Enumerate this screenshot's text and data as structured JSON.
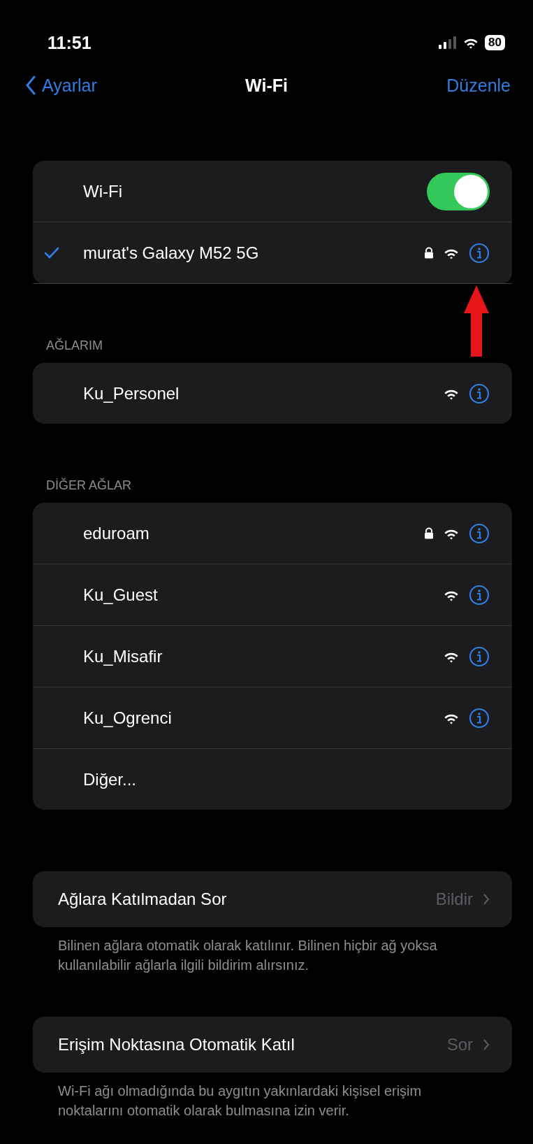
{
  "status_bar": {
    "time": "11:51",
    "battery": "80"
  },
  "nav": {
    "back": "Ayarlar",
    "title": "Wi-Fi",
    "action": "Düzenle"
  },
  "wifi_toggle": {
    "label": "Wi-Fi",
    "on": true
  },
  "connected": {
    "name": "murat's Galaxy M52 5G",
    "selected": true,
    "locked": true,
    "annotated": true
  },
  "sections": [
    {
      "header": "AĞLARIM",
      "networks": [
        {
          "kind": "network",
          "name": "Ku_Personel",
          "locked": false
        }
      ]
    },
    {
      "header": "DİĞER AĞLAR",
      "networks": [
        {
          "kind": "network",
          "name": "eduroam",
          "locked": true
        },
        {
          "kind": "network",
          "name": "Ku_Guest",
          "locked": false
        },
        {
          "kind": "network",
          "name": "Ku_Misafir",
          "locked": false
        },
        {
          "kind": "network",
          "name": "Ku_Ogrenci",
          "locked": false
        },
        {
          "kind": "other",
          "name": "Diğer..."
        }
      ]
    }
  ],
  "settings": [
    {
      "label": "Ağlara Katılmadan Sor",
      "value": "Bildir",
      "footer": "Bilinen ağlara otomatik olarak katılınır. Bilinen hiçbir ağ yoksa kullanılabilir ağlarla ilgili bildirim alırsınız."
    },
    {
      "label": "Erişim Noktasına Otomatik Katıl",
      "value": "Sor",
      "footer": "Wi-Fi ağı olmadığında bu aygıtın yakınlardaki kişisel erişim noktalarını otomatik olarak bulmasına izin verir."
    }
  ]
}
